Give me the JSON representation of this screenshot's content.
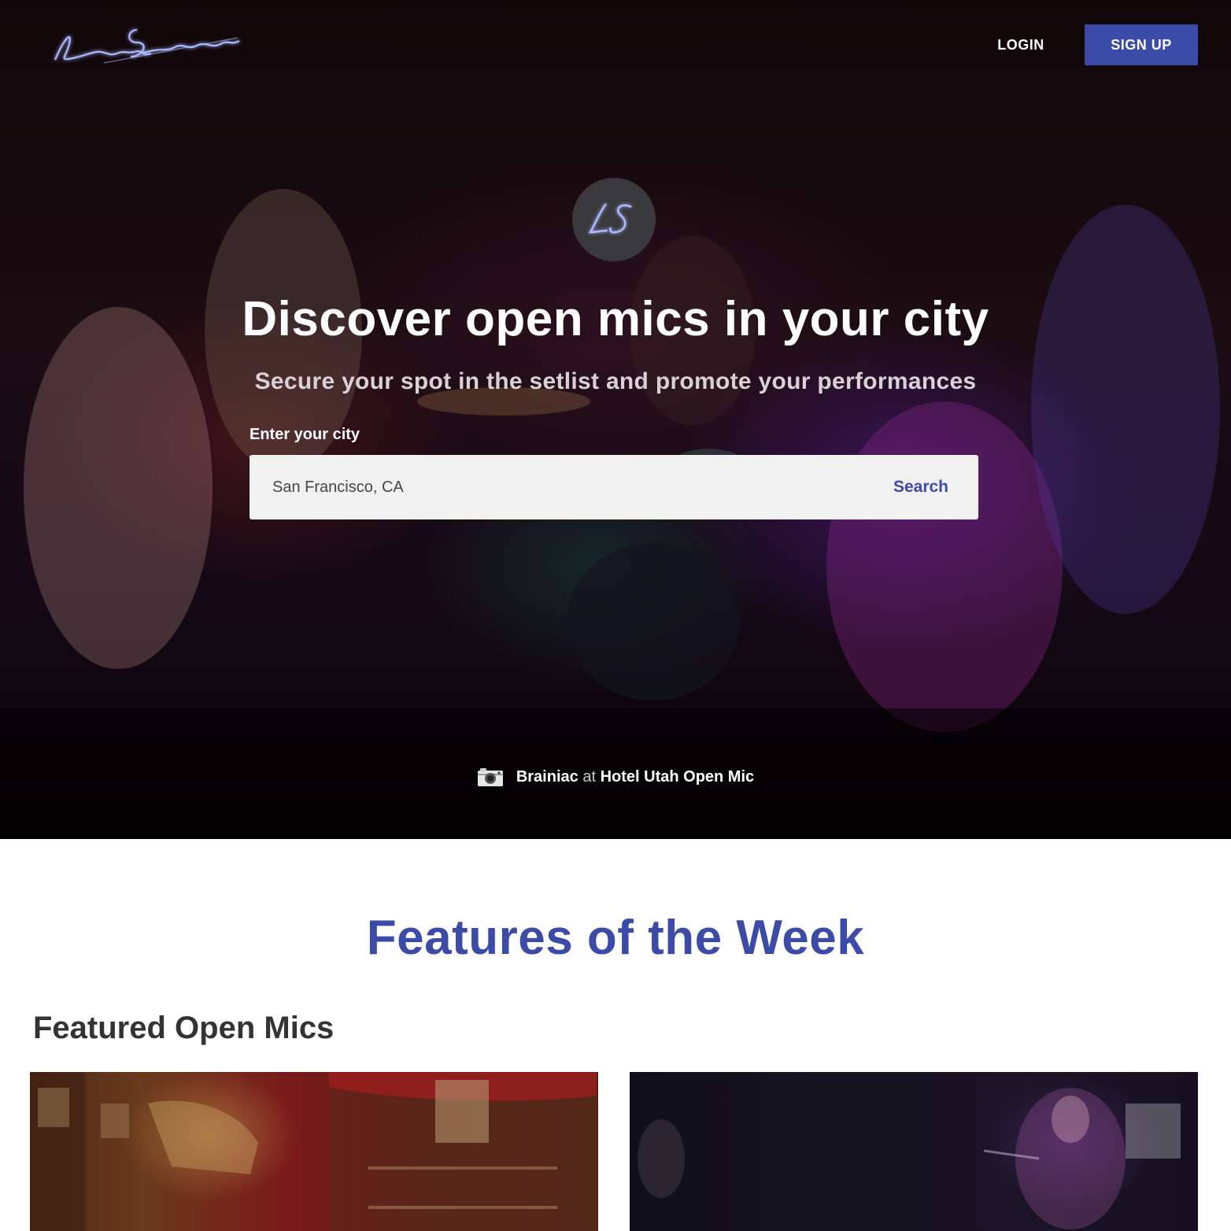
{
  "brand": {
    "name": "Local Sessions",
    "monogram": "LS"
  },
  "nav": {
    "login_label": "LOGIN",
    "signup_label": "SIGN UP"
  },
  "hero": {
    "title": "Discover open mics in your city",
    "subtitle": "Secure your spot in the setlist and promote your performances",
    "city_label": "Enter your city",
    "city_value": "San Francisco, CA",
    "search_label": "Search",
    "credit": {
      "performer": "Brainiac",
      "connector": "at",
      "venue": "Hotel Utah Open Mic"
    }
  },
  "features": {
    "title": "Features of the Week",
    "section_heading": "Featured Open Mics"
  },
  "colors": {
    "accent": "#3c4aa8",
    "neon_blue": "#aab8ff"
  },
  "icons": {
    "credit": "camera-icon"
  }
}
